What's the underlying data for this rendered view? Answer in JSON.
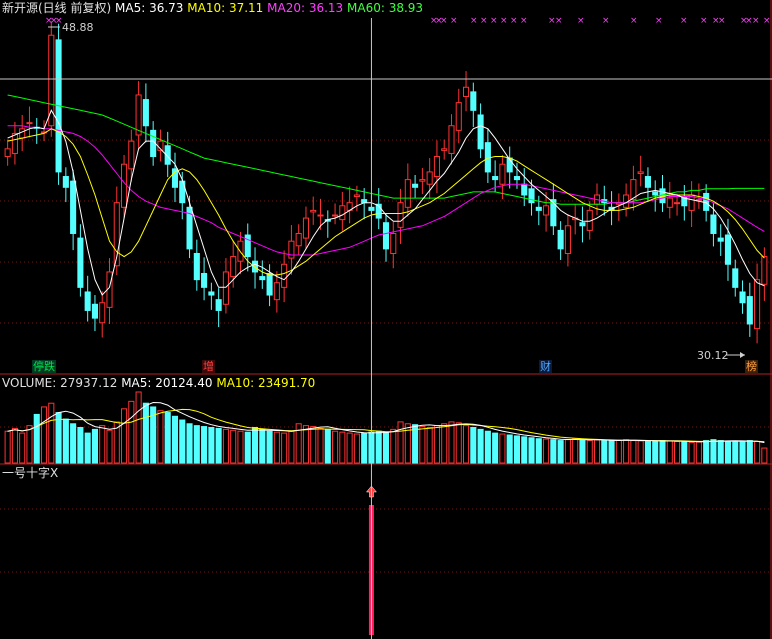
{
  "header": {
    "stock_title": "新开源(日线 前复权)",
    "ma5": "MA5: 36.73",
    "ma10": "MA10: 37.11",
    "ma20": "MA20: 36.13",
    "ma60": "MA60: 38.93"
  },
  "price_panel": {
    "high_label": "48.88",
    "low_label": "30.12",
    "tags": [
      {
        "text": "停跌",
        "color": "#00c040",
        "bg": "#004020"
      },
      {
        "text": "增",
        "color": "#ff3030",
        "bg": "#401010"
      },
      {
        "text": "财",
        "color": "#40a0ff",
        "bg": "#102040"
      },
      {
        "text": "榜",
        "color": "#ff9030",
        "bg": "#402010"
      }
    ]
  },
  "volume_panel": {
    "volume": "VOLUME: 27937.12",
    "ma5": "MA5: 20124.40",
    "ma10": "MA10: 23491.70"
  },
  "indicator_panel": {
    "title": "一号十字X"
  },
  "colors": {
    "up": "#ff3232",
    "down": "#54ffff",
    "ma5": "#ffffff",
    "ma10": "#ffff00",
    "ma20": "#ff00ff",
    "ma60": "#00ff00",
    "grid": "#7a1414"
  },
  "chart_data": {
    "type": "candlestick",
    "y_range": [
      27,
      50
    ],
    "high": 48.88,
    "low": 30.12,
    "closes": [
      41.5,
      42.5,
      42.8,
      43.2,
      42.9,
      42.6,
      48.88,
      40.0,
      39.0,
      36.0,
      32.5,
      31.0,
      30.5,
      31.5,
      33.5,
      38.0,
      40.5,
      42.0,
      45.0,
      43.0,
      41.0,
      42.0,
      40.5,
      39.0,
      38.0,
      35.0,
      33.0,
      32.5,
      32.0,
      31.0,
      33.5,
      34.5,
      35.5,
      34.5,
      33.5,
      33.0,
      32.0,
      32.8,
      34.0,
      35.5,
      36.0,
      37.0,
      37.5,
      37.2,
      36.8,
      37.2,
      37.8,
      38.0,
      38.5,
      38.0,
      37.5,
      37.0,
      35.0,
      36.0,
      38.0,
      39.5,
      39.0,
      39.5,
      40.0,
      41.0,
      41.5,
      43.0,
      44.5,
      45.5,
      44.0,
      41.5,
      40.0,
      39.5,
      40.5,
      40.0,
      39.5,
      38.5,
      38.0,
      37.5,
      37.8,
      36.5,
      35.0,
      36.5,
      37.0,
      36.5,
      37.5,
      38.5,
      38.0,
      37.5,
      38.0,
      38.5,
      39.5,
      40.0,
      39.0,
      38.5,
      38.0,
      38.3,
      38.0,
      37.8,
      38.5,
      38.2,
      37.5,
      36.0,
      35.5,
      34.0,
      32.5,
      31.5,
      30.12,
      33.0,
      34.5
    ],
    "volume": [
      17000,
      18500,
      16000,
      20000,
      26000,
      30000,
      32000,
      27000,
      23500,
      21000,
      19000,
      16000,
      18000,
      20000,
      17500,
      22000,
      29000,
      33000,
      38000,
      32000,
      30000,
      28000,
      27000,
      25000,
      23000,
      21000,
      20000,
      19500,
      19000,
      18500,
      18000,
      17500,
      17000,
      16500,
      19000,
      18000,
      17000,
      16500,
      16000,
      17000,
      21000,
      20000,
      19500,
      18500,
      18000,
      17000,
      16500,
      16000,
      15500,
      16000,
      16500,
      17000,
      16500,
      18000,
      22000,
      21000,
      20500,
      19500,
      19000,
      20000,
      21000,
      22000,
      21500,
      20000,
      19000,
      18000,
      17000,
      16000,
      15500,
      15000,
      14500,
      14000,
      13500,
      13000,
      12800,
      12500,
      12000,
      12500,
      13000,
      12500,
      12000,
      12300,
      12000,
      11800,
      12200,
      12500,
      12000,
      11800,
      11500,
      11700,
      12000,
      11800,
      11500,
      11300,
      11000,
      11200,
      12000,
      12500,
      12000,
      11500,
      11300,
      11800,
      12000,
      11500,
      8000
    ],
    "ma5": [
      42.2,
      42.4,
      42.6,
      42.8,
      42.9,
      42.8,
      44.0,
      43.2,
      42.0,
      40.0,
      37.5,
      35.0,
      33.0,
      32.0,
      32.5,
      34.5,
      37.0,
      39.5,
      41.5,
      42.0,
      42.0,
      41.5,
      41.0,
      40.5,
      39.5,
      38.0,
      36.5,
      35.0,
      33.5,
      32.5,
      32.5,
      33.0,
      33.5,
      33.8,
      34.0,
      33.8,
      33.5,
      33.2,
      33.0,
      33.5,
      34.2,
      35.0,
      35.8,
      36.5,
      36.9,
      37.0,
      37.2,
      37.5,
      37.8,
      38.0,
      38.0,
      37.8,
      37.2,
      36.8,
      36.8,
      37.2,
      37.6,
      38.2,
      38.8,
      39.4,
      39.9,
      40.6,
      41.3,
      42.2,
      42.8,
      43.0,
      42.8,
      42.2,
      41.5,
      40.8,
      40.2,
      39.7,
      39.2,
      38.8,
      38.4,
      38.0,
      37.5,
      37.2,
      37.0,
      36.8,
      36.8,
      37.0,
      37.3,
      37.6,
      37.8,
      38.0,
      38.3,
      38.6,
      38.7,
      38.8,
      38.7,
      38.6,
      38.5,
      38.3,
      38.2,
      38.1,
      38.0,
      37.6,
      37.0,
      36.2,
      35.3,
      34.3,
      33.4,
      32.8,
      32.6
    ],
    "ma10": [
      42.0,
      42.1,
      42.2,
      42.3,
      42.4,
      42.5,
      42.8,
      42.6,
      42.3,
      41.8,
      41.0,
      39.8,
      38.5,
      37.0,
      35.5,
      34.8,
      34.5,
      34.8,
      35.5,
      36.5,
      37.5,
      38.5,
      39.5,
      40.0,
      40.2,
      40.0,
      39.5,
      38.8,
      38.0,
      37.2,
      36.3,
      35.5,
      34.8,
      34.2,
      33.8,
      33.5,
      33.3,
      33.3,
      33.4,
      33.6,
      33.9,
      34.2,
      34.6,
      35.0,
      35.4,
      35.8,
      36.1,
      36.4,
      36.7,
      37.0,
      37.2,
      37.3,
      37.3,
      37.3,
      37.3,
      37.4,
      37.6,
      37.8,
      38.0,
      38.3,
      38.6,
      39.0,
      39.4,
      39.8,
      40.2,
      40.6,
      40.9,
      41.0,
      41.0,
      40.9,
      40.7,
      40.4,
      40.1,
      39.8,
      39.5,
      39.2,
      38.9,
      38.6,
      38.3,
      38.0,
      37.8,
      37.6,
      37.5,
      37.5,
      37.5,
      37.6,
      37.7,
      37.9,
      38.1,
      38.3,
      38.4,
      38.5,
      38.5,
      38.5,
      38.5,
      38.4,
      38.3,
      38.1,
      37.8,
      37.4,
      36.9,
      36.3,
      35.6,
      34.9,
      34.4
    ],
    "ma20": [
      43.0,
      43.0,
      43.0,
      42.9,
      42.9,
      42.8,
      42.8,
      42.7,
      42.6,
      42.5,
      42.3,
      42.0,
      41.6,
      41.1,
      40.5,
      39.9,
      39.3,
      38.8,
      38.4,
      38.1,
      37.9,
      37.7,
      37.6,
      37.5,
      37.4,
      37.3,
      37.1,
      36.9,
      36.7,
      36.4,
      36.2,
      36.0,
      35.8,
      35.6,
      35.4,
      35.2,
      35.0,
      34.8,
      34.7,
      34.6,
      34.6,
      34.6,
      34.6,
      34.7,
      34.8,
      34.9,
      35.0,
      35.1,
      35.3,
      35.5,
      35.7,
      35.9,
      36.0,
      36.1,
      36.2,
      36.3,
      36.4,
      36.5,
      36.7,
      36.9,
      37.1,
      37.4,
      37.7,
      38.0,
      38.3,
      38.6,
      38.8,
      39.0,
      39.1,
      39.2,
      39.2,
      39.2,
      39.1,
      39.0,
      38.9,
      38.8,
      38.7,
      38.6,
      38.5,
      38.4,
      38.3,
      38.2,
      38.1,
      38.0,
      38.0,
      38.0,
      38.0,
      38.0,
      38.1,
      38.2,
      38.3,
      38.4,
      38.4,
      38.4,
      38.4,
      38.3,
      38.2,
      38.0,
      37.8,
      37.6,
      37.3,
      37.0,
      36.7,
      36.4,
      36.13
    ],
    "ma60": [
      45.0,
      44.9,
      44.8,
      44.7,
      44.6,
      44.5,
      44.4,
      44.3,
      44.2,
      44.1,
      44.0,
      43.9,
      43.8,
      43.7,
      43.5,
      43.3,
      43.1,
      42.9,
      42.7,
      42.5,
      42.3,
      42.1,
      41.9,
      41.7,
      41.5,
      41.3,
      41.1,
      40.9,
      40.8,
      40.7,
      40.6,
      40.5,
      40.4,
      40.3,
      40.2,
      40.1,
      40.0,
      39.9,
      39.8,
      39.7,
      39.6,
      39.5,
      39.4,
      39.3,
      39.2,
      39.1,
      39.0,
      38.9,
      38.8,
      38.7,
      38.6,
      38.5,
      38.4,
      38.3,
      38.3,
      38.3,
      38.3,
      38.3,
      38.3,
      38.3,
      38.3,
      38.4,
      38.5,
      38.6,
      38.7,
      38.7,
      38.7,
      38.7,
      38.6,
      38.5,
      38.4,
      38.3,
      38.2,
      38.1,
      38.0,
      38.0,
      37.9,
      37.9,
      37.9,
      37.9,
      37.9,
      37.9,
      37.9,
      38.0,
      38.0,
      38.0,
      38.1,
      38.2,
      38.3,
      38.4,
      38.5,
      38.6,
      38.7,
      38.7,
      38.8,
      38.8,
      38.9,
      38.9,
      38.9,
      38.9,
      38.93,
      38.93,
      38.93,
      38.93,
      38.93
    ],
    "cursor_index": 50,
    "signal_index": 50
  }
}
